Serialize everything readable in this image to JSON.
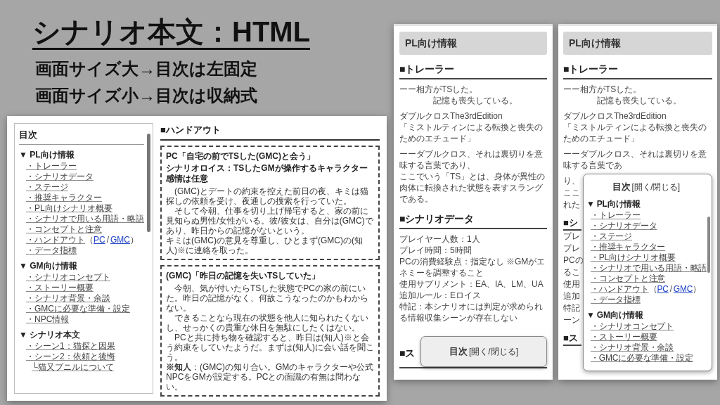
{
  "slide": {
    "title": "シナリオ本文：HTML",
    "points": [
      "画面サイズ大→目次は左固定",
      "画面サイズ小→目次は収納式"
    ]
  },
  "desktop_view": {
    "toc": {
      "title": "目次",
      "sections": [
        {
          "heading": "▼ PL向け情報",
          "items": [
            {
              "label": "・トレーラー"
            },
            {
              "label": "・シナリオデータ"
            },
            {
              "label": "・ステージ"
            },
            {
              "label": "・推奨キャラクター"
            },
            {
              "label": "・PL向けシナリオ概要"
            },
            {
              "label": "・シナリオで用いる用語・略語"
            },
            {
              "label": "・コンセプトと注意"
            },
            {
              "label": "・ハンドアウト",
              "brackets": [
                "（",
                "）"
              ],
              "separator": "/",
              "sublinks": [
                "PC",
                "GMC"
              ]
            },
            {
              "label": "・データ指標"
            }
          ]
        },
        {
          "heading": "▼ GM向け情報",
          "items": [
            {
              "label": "・シナリオコンセプト"
            },
            {
              "label": "・ストーリー概要"
            },
            {
              "label": "・シナリオ背景・余談"
            },
            {
              "label": "・GMCに必要な準備・設定"
            },
            {
              "label": "・NPC情報"
            }
          ]
        },
        {
          "heading": "▼ シナリオ本文",
          "items": [
            {
              "label": "・シーン1：猫探と因果"
            },
            {
              "label": "・シーン2：依頼と後悔",
              "children": [
                {
                  "label": "└猫又プニルについて"
                }
              ]
            }
          ]
        }
      ]
    },
    "content": {
      "heading": "■ハンドアウト",
      "handouts": [
        {
          "title": "PC「自宅の前でTSした(GMC)と会う」",
          "subtitle_parts": [
            "シナリオロイス：TSしたGMが操作するキャラクター",
            "感情は任意"
          ],
          "paragraphs": [
            {
              "kind": "indented",
              "text": "(GMC)とデートの約束を控えた前日の夜、キミは猫探しの依頼を受け、夜通しの捜索を行っていた。"
            },
            {
              "kind": "indented",
              "text": "そして今朝、仕事を切り上げ帰宅すると、家の前に見知らぬ男性/女性がいる。彼/彼女は、自分は(GMC)であり、昨日からの記憶がないという。"
            },
            {
              "kind": "flush",
              "text": "キミは(GMC)の意見を尊重し、ひとまず(GMC)の(知人)※に連絡を取った。"
            }
          ]
        },
        {
          "title": "(GMC)「昨日の記憶を失いTSしていた」",
          "paragraphs": [
            {
              "kind": "indented",
              "text": "今朝、気が付いたらTSした状態でPCの家の前にいた。昨日の記憶がなく、何故こうなったのかもわからない。"
            },
            {
              "kind": "indented",
              "text": "できることなら現在の状態を他人に知られたくないし、せっかくの貴重な休日を無駄にしたくはない。"
            },
            {
              "kind": "indented",
              "text": "PCと共に持ち物を確認すると、昨日は(知人)※と会う約束をしていたようだ。まずは(知人)に会い話を聞こう。"
            },
            {
              "kind": "flush",
              "text": "**※知人**：(GMC)の知り合い。GMのキャラクターや公式NPCをGMが設定する。PCとの面識の有無は問わない。"
            }
          ]
        }
      ]
    }
  },
  "mobile_closed": {
    "banner": "PL向け情報",
    "sections": [
      {
        "heading": "■トレーラー",
        "blocks": [
          {
            "kind": "verse",
            "lines": [
              "ーー相方がTSした。",
              "記憶も喪失している。"
            ]
          },
          {
            "kind": "plain",
            "lines": [
              "ダブルクロスThe3rdEdition",
              "「ミストルティンによる転換と喪失のためのエチュード」"
            ]
          },
          {
            "kind": "plain",
            "lines": [
              "ーーダブルクロス、それは裏切りを意味する言葉であり、",
              "ここでいう「TS」とは、身体が異性の肉体に転換された状態を表すスラングである。"
            ]
          }
        ]
      },
      {
        "heading": "■シナリオデータ",
        "blocks": [
          {
            "kind": "plain",
            "lines": [
              "プレイヤー人数：1人",
              "プレイ時間：5時間",
              "PCの消費経験点：指定なし ※GMがエネミーを調整すること",
              "使用サプリメント：EA、IA、LM、UA",
              "追加ルール：Eロイス",
              "特記：本シナリオには判定が求められる情報収集シーンが存在しない"
            ]
          }
        ]
      }
    ],
    "cut_heading": "■ス",
    "toc_button": {
      "label": "目次",
      "hint": "[開く/閉じる]"
    }
  },
  "mobile_open": {
    "banner": "PL向け情報",
    "sections": [
      {
        "heading": "■トレーラー",
        "blocks": [
          {
            "kind": "verse",
            "lines": [
              "ーー相方がTSした。",
              "記憶も喪失している。"
            ]
          },
          {
            "kind": "plain",
            "lines": [
              "ダブルクロスThe3rdEdition",
              "「ミストルティンによる転換と喪失のためのエチュード」"
            ]
          },
          {
            "kind": "plain",
            "lines": [
              "ーーダブルクロス、それは裏切りを意味する言葉であ"
            ]
          }
        ]
      }
    ],
    "fragments": [
      {
        "kind": "text",
        "text": "り、"
      },
      {
        "kind": "text",
        "text": "ここ"
      },
      {
        "kind": "text",
        "text": "れた"
      },
      {
        "kind": "heading",
        "text": "■シ"
      },
      {
        "kind": "text",
        "text": "プレ"
      },
      {
        "kind": "text",
        "text": "プレ"
      },
      {
        "kind": "text",
        "text": "PCの"
      },
      {
        "kind": "text",
        "text": "るこ"
      },
      {
        "kind": "text",
        "text": "使用"
      },
      {
        "kind": "text",
        "text": "追加"
      },
      {
        "kind": "text",
        "text": "特記"
      },
      {
        "kind": "text",
        "text": "ーン"
      },
      {
        "kind": "heading",
        "text": "■ス"
      }
    ],
    "popup": {
      "toggle": {
        "label": "目次",
        "hint": "[開く/閉じる]"
      },
      "sections": [
        {
          "heading": "▼ PL向け情報",
          "items": [
            {
              "label": "・トレーラー"
            },
            {
              "label": "・シナリオデータ"
            },
            {
              "label": "・ステージ"
            },
            {
              "label": "・推奨キャラクター"
            },
            {
              "label": "・PL向けシナリオ概要"
            },
            {
              "label": "・シナリオで用いる用語・略語"
            },
            {
              "label": "・コンセプトと注意"
            },
            {
              "label": "・ハンドアウト",
              "brackets": [
                "（",
                "）"
              ],
              "separator": "/",
              "sublinks": [
                "PC",
                "GMC"
              ]
            },
            {
              "label": "・データ指標"
            }
          ]
        },
        {
          "heading": "▼ GM向け情報",
          "items": [
            {
              "label": "・シナリオコンセプト"
            },
            {
              "label": "・ストーリー概要"
            },
            {
              "label": "・シナリオ背景・余談"
            },
            {
              "label": "・GMCに必要な準備・設定"
            }
          ]
        }
      ]
    }
  }
}
